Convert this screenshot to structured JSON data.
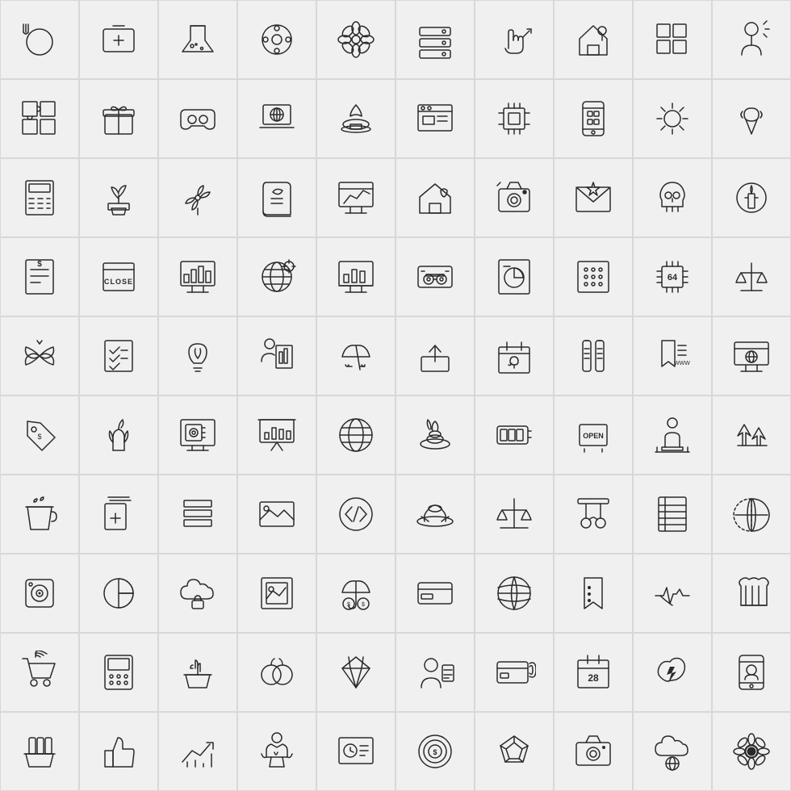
{
  "grid": {
    "cols": 10,
    "rows": 10,
    "icons": [
      "dinner-plate",
      "first-aid-kit",
      "chemistry-flask",
      "film-reel",
      "flower",
      "server-stack",
      "hand-gesture",
      "house-pin",
      "grid-layout",
      "person-idea",
      "puzzle-piece",
      "gift-box",
      "vr-headset",
      "laptop-globe",
      "fountain",
      "browser-window",
      "circuit-board",
      "smartphone-app",
      "sun",
      "ice-cream",
      "calculator",
      "plant-pot",
      "pinwheel",
      "scroll-leaf",
      "monitor-chart",
      "house-tag",
      "camera-flash",
      "envelope-star",
      "skull",
      "candle-ritual",
      "dollar-document",
      "close-sign",
      "monitor-stats",
      "globe-gear",
      "bar-chart-screen",
      "cassette-player",
      "pie-chart-doc",
      "keypad",
      "cpu-chip",
      "balance-scale-stand",
      "butterfly",
      "checklist",
      "lightbulb-plant",
      "person-chart",
      "beach-umbrella",
      "upload-box",
      "rabbit-calendar",
      "battery-tubes",
      "bookmarks-www",
      "globe-screen",
      "price-tag",
      "plant-water",
      "safe-monitor",
      "chart-presentation",
      "globe-circle",
      "spa-stones",
      "battery-gauge",
      "open-sign",
      "podium-person",
      "forest-spa",
      "coffee-cup",
      "file-stack-plus",
      "stacked-layers",
      "landscape-image",
      "code-circle",
      "cowboy-hat",
      "justice-scale",
      "pendulum",
      "notebook-lines",
      "world-half",
      "speaker",
      "pie-chart-circle",
      "cloud-lock",
      "framed-picture",
      "umbrella-money",
      "credit-card",
      "basketball",
      "bookmark-dots",
      "heartbeat",
      "bread-loaf",
      "shopping-cart-wifi",
      "pos-calculator",
      "basket-cactus",
      "fruits",
      "diamond",
      "person-card",
      "online-payment",
      "calendar-28",
      "hand-lightning",
      "phone-profile",
      "bottles-basket",
      "thumbs-up",
      "growth-arrow",
      "person-strength",
      "clock-board",
      "dollar-target",
      "radar-chart",
      "camera-digital",
      "cloud-globe",
      "sunflower"
    ]
  }
}
